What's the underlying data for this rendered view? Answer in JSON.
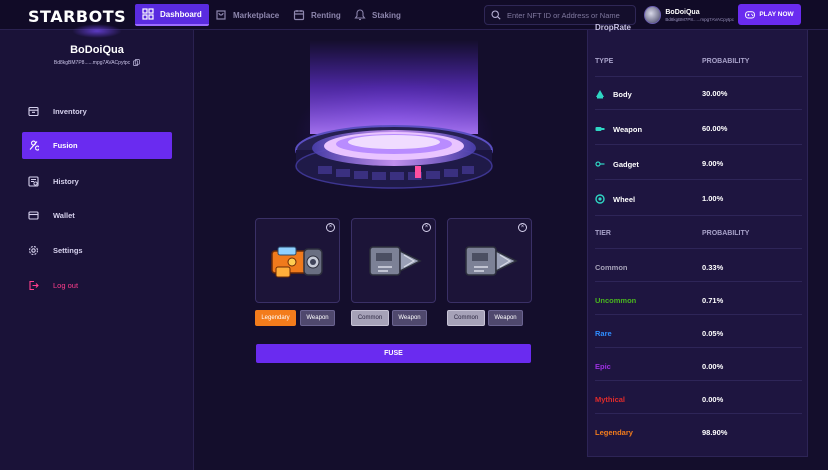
{
  "app": {
    "logo": "STARBOTS"
  },
  "nav": [
    {
      "label": "Dashboard",
      "active": true
    },
    {
      "label": "Marketplace",
      "active": false
    },
    {
      "label": "Renting",
      "active": false
    },
    {
      "label": "Staking",
      "active": false
    }
  ],
  "search": {
    "placeholder": "Enter NFT ID or Address or Name"
  },
  "user": {
    "name": "BoDoiQua",
    "address_short": "Bd8kgBM7P8......mpg7AVACpytpc",
    "chip_name": "BoDoiQua",
    "chip_address": "Bd8kgBM7P8......mpg7AVACpytpc"
  },
  "play_button": "PLAY NOW",
  "sidebar": {
    "items": [
      {
        "label": "Inventory",
        "icon": "inventory-icon",
        "active": false
      },
      {
        "label": "Fusion",
        "icon": "fusion-icon",
        "active": true
      },
      {
        "label": "History",
        "icon": "history-icon",
        "active": false
      },
      {
        "label": "Wallet",
        "icon": "wallet-icon",
        "active": false
      },
      {
        "label": "Settings",
        "icon": "gear-icon",
        "active": false
      },
      {
        "label": "Log out",
        "icon": "logout-icon",
        "active": false
      }
    ]
  },
  "fusion": {
    "cards": [
      {
        "tier": "Legendary",
        "type": "Weapon",
        "item": "orange-cannon"
      },
      {
        "tier": "Common",
        "type": "Weapon",
        "item": "steel-drill"
      },
      {
        "tier": "Common",
        "type": "Weapon",
        "item": "steel-drill"
      }
    ],
    "close_symbol": "×",
    "fuse_label": "FUSE"
  },
  "droprate": {
    "title": "DropRate",
    "type_header": "TYPE",
    "prob_header": "PROBABILITY",
    "types": [
      {
        "name": "Body",
        "value": "30.00%",
        "icon": "body-icon"
      },
      {
        "name": "Weapon",
        "value": "60.00%",
        "icon": "weapon-icon"
      },
      {
        "name": "Gadget",
        "value": "9.00%",
        "icon": "gadget-icon"
      },
      {
        "name": "Wheel",
        "value": "1.00%",
        "icon": "wheel-icon"
      }
    ],
    "tier_header": "TIER",
    "tier_prob_header": "PROBABILITY",
    "tiers": [
      {
        "name": "Common",
        "value": "0.33%",
        "color": "#a6a2b8"
      },
      {
        "name": "Uncommon",
        "value": "0.71%",
        "color": "#49b51f"
      },
      {
        "name": "Rare",
        "value": "0.05%",
        "color": "#2f8dff"
      },
      {
        "name": "Epic",
        "value": "0.00%",
        "color": "#9b2fe0"
      },
      {
        "name": "Mythical",
        "value": "0.00%",
        "color": "#e02b2b"
      },
      {
        "name": "Legendary",
        "value": "98.90%",
        "color": "#f37c1c"
      }
    ]
  },
  "colors": {
    "accent": "#6a2bf0",
    "background": "#140e2c",
    "logout": "#ff3d8c"
  }
}
